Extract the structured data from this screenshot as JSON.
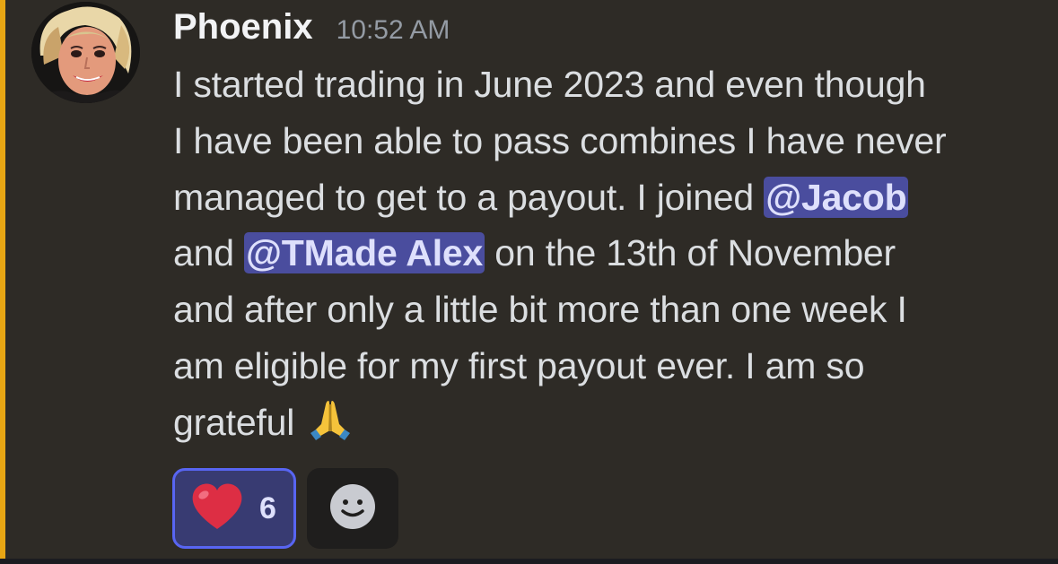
{
  "message": {
    "author": "Phoenix",
    "timestamp": "10:52 AM",
    "lines": [
      {
        "before": "I started trading in June 2023 and even though"
      },
      {
        "before": "I have been able to pass combines I have never"
      },
      {
        "before": "managed to get to a payout. I joined ",
        "mention": "@Jacob"
      },
      {
        "before": "and ",
        "mention": "@TMade Alex",
        "after": " on the 13th of November"
      },
      {
        "before": "and after only a little bit more than one week I"
      },
      {
        "before": "am eligible for my first payout ever. I am so"
      },
      {
        "before": "grateful"
      }
    ],
    "trailing_emoji": "folded-hands-emoji"
  },
  "reactions": [
    {
      "emoji": "red-heart-emoji",
      "count": "6",
      "selected": true
    }
  ],
  "add_reaction_icon": "smiley-face-icon",
  "colors": {
    "background": "#2e2b26",
    "accent_bar": "#e8a614",
    "mention_bg": "#4a4d9e",
    "mention_text": "#dee0fc",
    "reaction_border": "#5865f2"
  }
}
